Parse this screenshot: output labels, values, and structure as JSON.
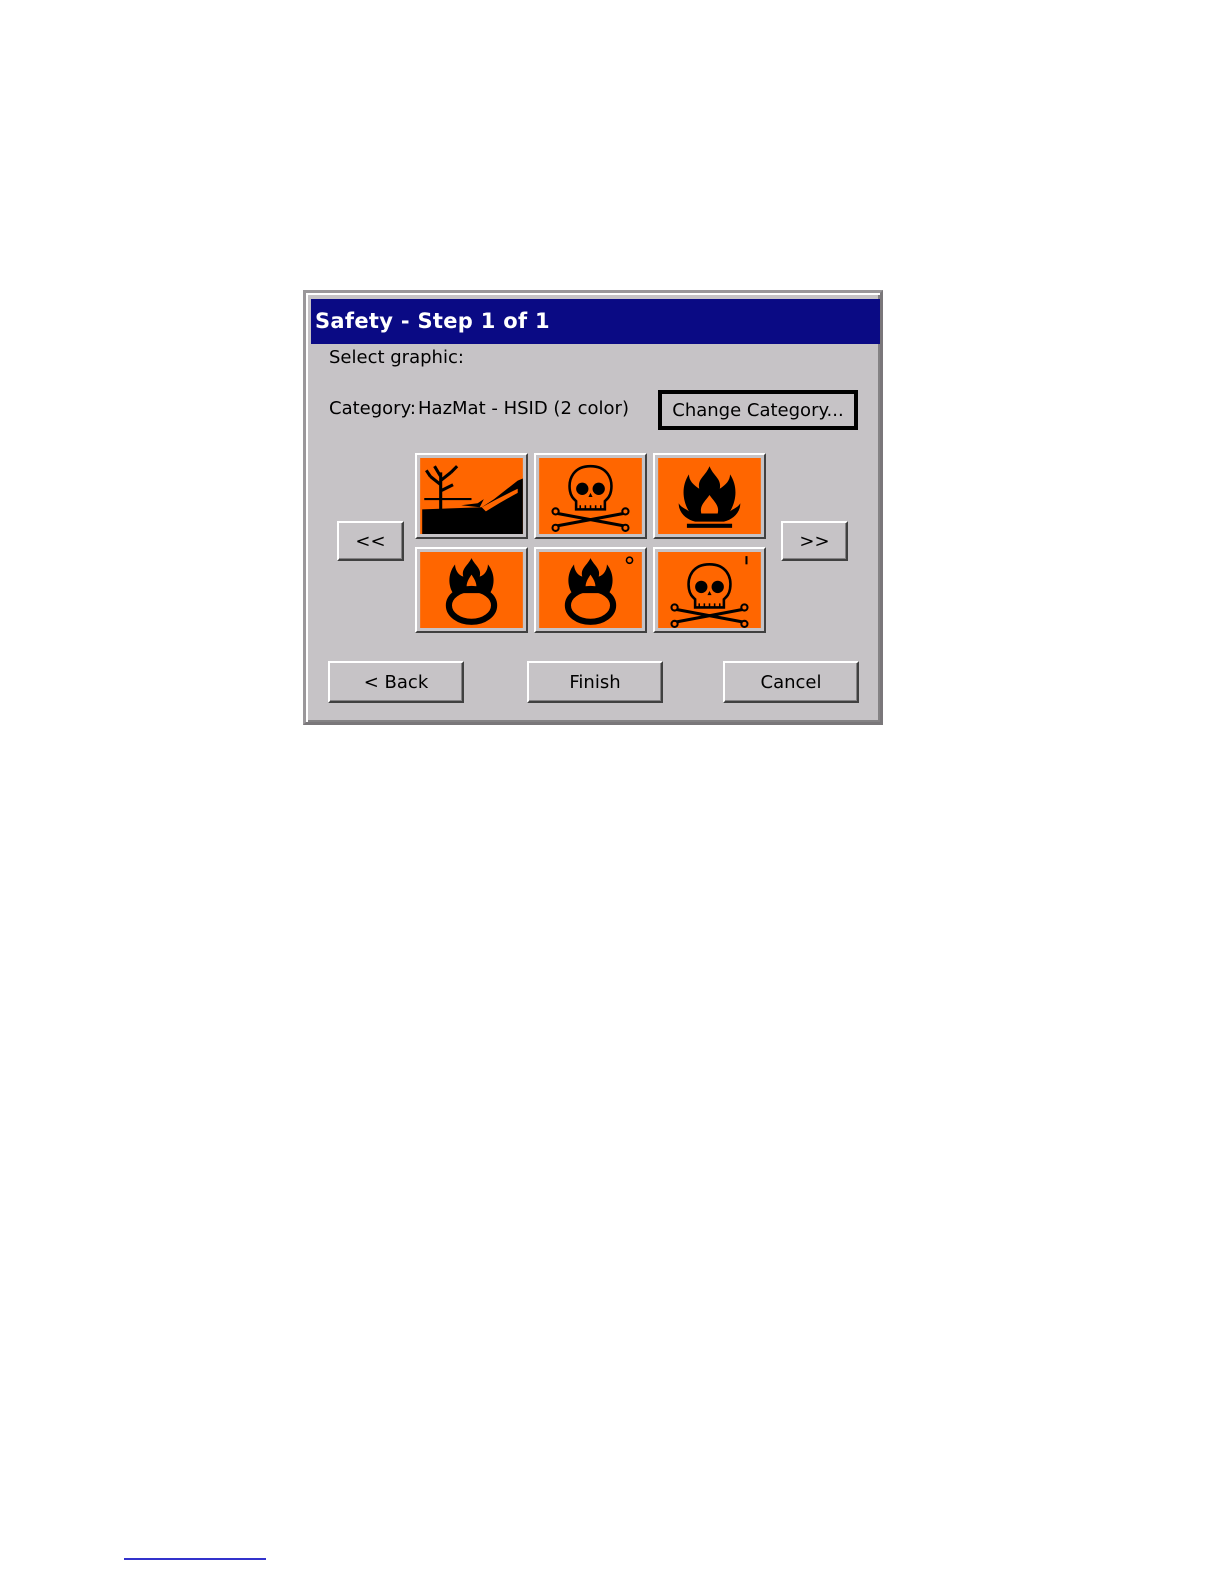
{
  "dialog": {
    "title": "Safety - Step 1 of 1",
    "prompt": "Select graphic:",
    "category_label": "Category:",
    "category_value": "HazMat - HSID (2 color)",
    "change_category_label": "Change Category...",
    "prev_label": "<<",
    "next_label": ">>",
    "back_label": "< Back",
    "finish_label": "Finish",
    "cancel_label": "Cancel"
  },
  "symbols": [
    {
      "name": "environment-hazard-icon"
    },
    {
      "name": "toxic-skull-icon"
    },
    {
      "name": "flammable-flame-icon"
    },
    {
      "name": "oxidizer-flame-over-circle-icon"
    },
    {
      "name": "oxidizer-flame-over-circle-icon"
    },
    {
      "name": "toxic-skull-icon"
    }
  ],
  "colors": {
    "title_bar": "#0a0a84",
    "dialog_bg": "#c6c3c6",
    "symbol_bg": "#ff6600"
  }
}
